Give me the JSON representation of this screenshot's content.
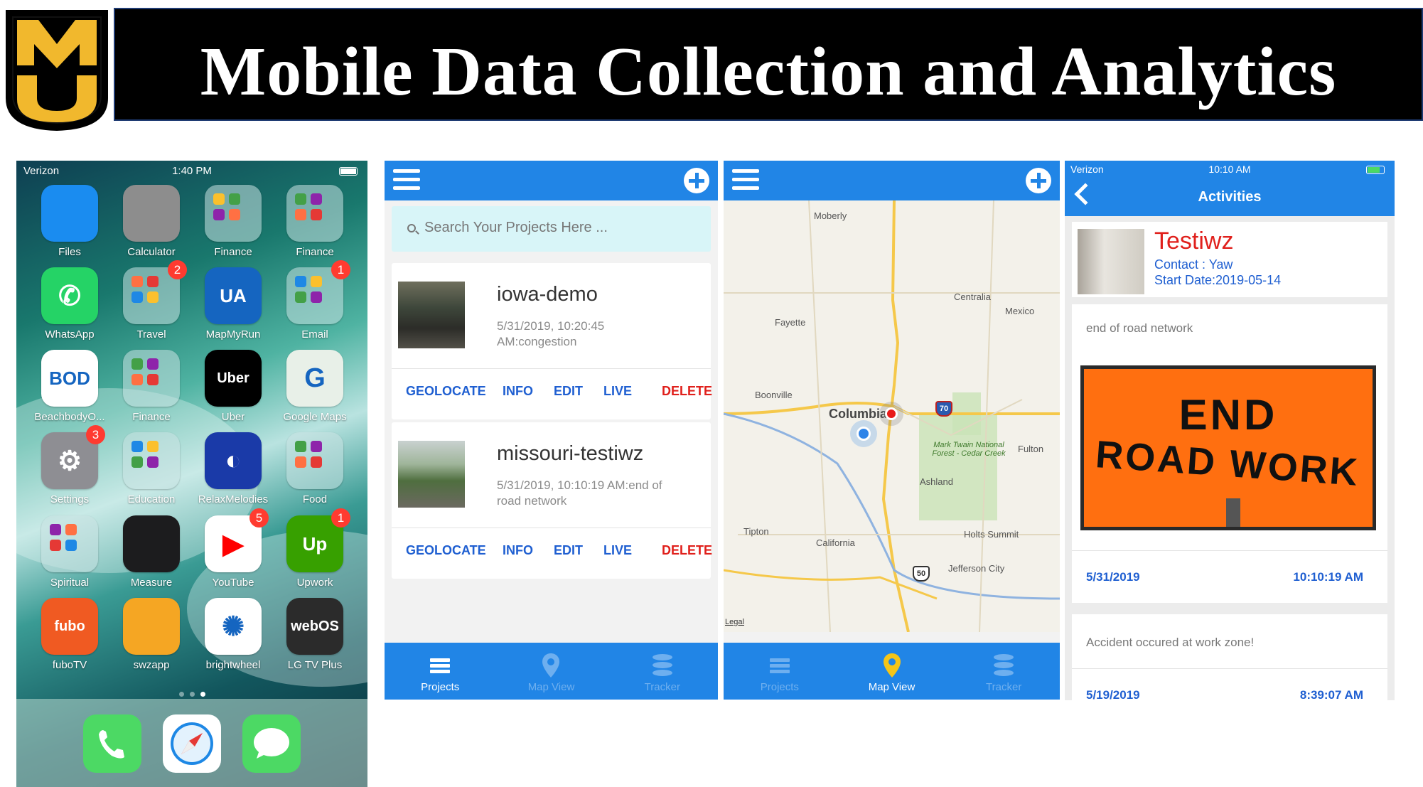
{
  "banner": {
    "title": "Mobile Data Collection and Analytics",
    "logo_text": "MU"
  },
  "home_screen": {
    "status": {
      "carrier": "Verizon",
      "time": "1:40 PM"
    },
    "apps": [
      {
        "label": "Files",
        "color": "#1a8cf0",
        "glyph": ""
      },
      {
        "label": "Calculator",
        "color": "#8d8d8d",
        "glyph": ""
      },
      {
        "label": "Finance",
        "color": "folder",
        "glyph": ""
      },
      {
        "label": "Finance",
        "color": "folder",
        "glyph": ""
      },
      {
        "label": "WhatsApp",
        "color": "#25d366",
        "glyph": "✆"
      },
      {
        "label": "Travel",
        "color": "folder",
        "glyph": "",
        "badge": "2"
      },
      {
        "label": "MapMyRun",
        "color": "#1565c0",
        "glyph": "UA"
      },
      {
        "label": "Email",
        "color": "folder",
        "glyph": "",
        "badge": "1"
      },
      {
        "label": "BeachbodyO...",
        "color": "#ffffff",
        "glyph": "BOD"
      },
      {
        "label": "Finance",
        "color": "folder",
        "glyph": ""
      },
      {
        "label": "Uber",
        "color": "#000000",
        "glyph": "Uber"
      },
      {
        "label": "Google Maps",
        "color": "#e8f0e8",
        "glyph": "G"
      },
      {
        "label": "Settings",
        "color": "#8e8e93",
        "glyph": "⚙",
        "badge": "3"
      },
      {
        "label": "Education",
        "color": "folder",
        "glyph": ""
      },
      {
        "label": "RelaxMelodies",
        "color": "#1a3aa8",
        "glyph": "◐"
      },
      {
        "label": "Food",
        "color": "folder",
        "glyph": ""
      },
      {
        "label": "Spiritual",
        "color": "folder",
        "glyph": ""
      },
      {
        "label": "Measure",
        "color": "#1c1c1e",
        "glyph": ""
      },
      {
        "label": "YouTube",
        "color": "#ffffff",
        "glyph": "▶",
        "badge": "5"
      },
      {
        "label": "Upwork",
        "color": "#37a000",
        "glyph": "Up",
        "badge": "1"
      },
      {
        "label": "fuboTV",
        "color": "#f05a22",
        "glyph": "fubo"
      },
      {
        "label": "swzapp",
        "color": "#f5a623",
        "glyph": ""
      },
      {
        "label": "brightwheel",
        "color": "#ffffff",
        "glyph": "✺"
      },
      {
        "label": "LG TV Plus",
        "color": "#2b2b2b",
        "glyph": "webOS"
      }
    ],
    "dock": [
      {
        "name": "phone",
        "color": "#4cd964"
      },
      {
        "name": "safari",
        "color": "#ffffff"
      },
      {
        "name": "messages",
        "color": "#4cd964"
      }
    ]
  },
  "projects_screen": {
    "search_placeholder": "Search Your Projects Here ...",
    "projects": [
      {
        "name": "iowa-demo",
        "meta": "5/31/2019, 10:20:45 AM:congestion"
      },
      {
        "name": "missouri-testiwz",
        "meta": "5/31/2019, 10:10:19 AM:end of road network"
      }
    ],
    "actions": [
      "GEOLOCATE",
      "INFO",
      "EDIT",
      "LIVE",
      "DELETE"
    ],
    "tabs": [
      "Projects",
      "Map View",
      "Tracker"
    ],
    "active_tab": "Projects"
  },
  "map_screen": {
    "cities": [
      "Moberly",
      "Centralia",
      "Mexico",
      "Fayette",
      "Boonville",
      "Columbia",
      "Fulton",
      "Mark Twain National Forest - Cedar Creek",
      "Ashland",
      "Tipton",
      "California",
      "Holts Summit",
      "Jefferson City"
    ],
    "shields": [
      "70",
      "50"
    ],
    "legal": "Legal",
    "tabs": [
      "Projects",
      "Map View",
      "Tracker"
    ],
    "active_tab": "Map View"
  },
  "activities_screen": {
    "status": {
      "carrier": "Verizon",
      "time": "10:10 AM"
    },
    "title": "Activities",
    "project": {
      "name": "Testiwz",
      "contact": "Contact : Yaw",
      "start": "Start Date:2019-05-14"
    },
    "activities": [
      {
        "note": "end of road network",
        "date": "5/31/2019",
        "time": "10:10:19 AM",
        "sign_line1": "END",
        "sign_line2": "ROAD WORK"
      },
      {
        "note": "Accident occured at work zone!",
        "date": "5/19/2019",
        "time": "8:39:07 AM"
      }
    ]
  }
}
